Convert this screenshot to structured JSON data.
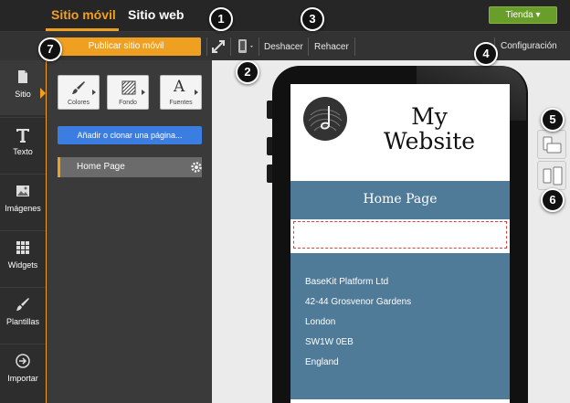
{
  "header": {
    "tabs": [
      {
        "label": "Sitio móvil",
        "active": true
      },
      {
        "label": "Sitio web",
        "active": false
      }
    ],
    "store_button": "Tienda ▾"
  },
  "toolbar": {
    "publish_label": "Publicar sitio móvil",
    "undo_label": "Deshacer",
    "redo_label": "Rehacer",
    "settings_label": "Configuración"
  },
  "leftnav": {
    "items": [
      {
        "label": "Sitio",
        "icon": "page-icon"
      },
      {
        "label": "Texto",
        "icon": "text-icon"
      },
      {
        "label": "Imágenes",
        "icon": "image-icon"
      },
      {
        "label": "Widgets",
        "icon": "grid-icon"
      },
      {
        "label": "Plantillas",
        "icon": "brush-icon"
      },
      {
        "label": "Importar",
        "icon": "import-icon"
      }
    ]
  },
  "panel": {
    "tools": [
      {
        "label": "Colores",
        "icon": "brush-icon"
      },
      {
        "label": "Fondo",
        "icon": "background-icon"
      },
      {
        "label": "Fuentes",
        "icon": "font-icon"
      }
    ],
    "add_page_label": "Añadir o clonar una página...",
    "pages": [
      {
        "label": "Home Page"
      }
    ]
  },
  "preview": {
    "site_title_line1": "My",
    "site_title_line2": "Website",
    "page_title": "Home Page",
    "address": [
      "BaseKit Platform Ltd",
      "42-44 Grosvenor Gardens",
      "London",
      "SW1W 0EB",
      "England"
    ]
  },
  "callouts": [
    "1",
    "2",
    "3",
    "4",
    "5",
    "6",
    "7"
  ],
  "colors": {
    "accent": "#f0a020",
    "store_green": "#6a9e2a",
    "add_blue": "#3b7de0",
    "band_blue": "#4f7a98"
  }
}
